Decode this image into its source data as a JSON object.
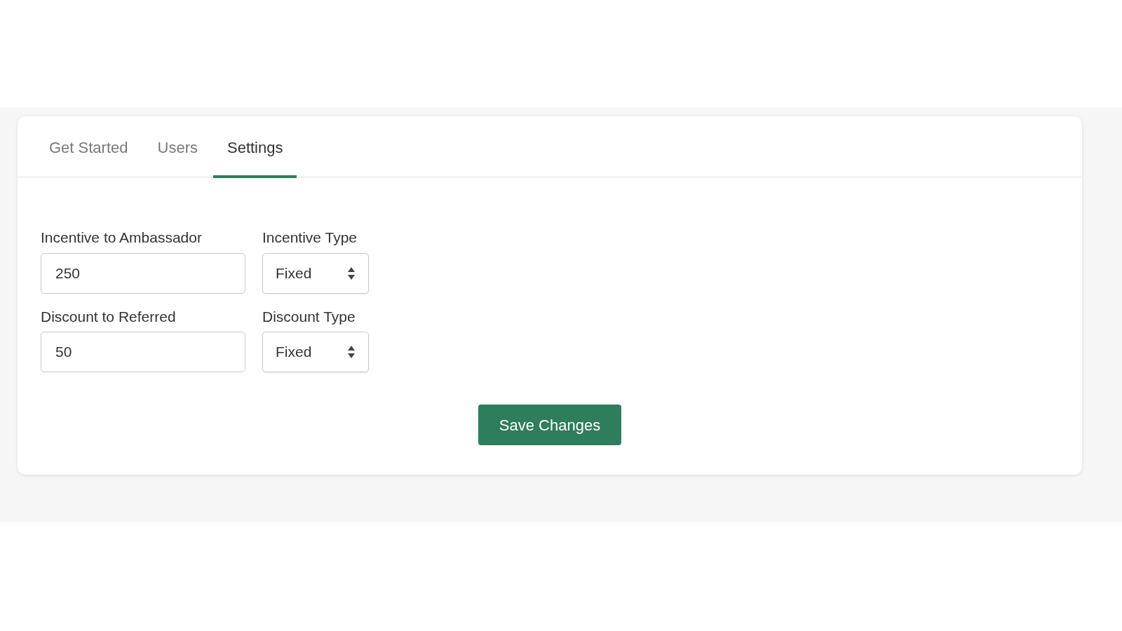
{
  "tabs": [
    {
      "label": "Get Started",
      "selected": false
    },
    {
      "label": "Users",
      "selected": false
    },
    {
      "label": "Settings",
      "selected": true
    }
  ],
  "fields": [
    {
      "label": "Incentive to Ambassador",
      "value": "250",
      "type_label": "Incentive Type",
      "type_value": "Fixed"
    },
    {
      "label": "Discount to Referred",
      "value": "50",
      "type_label": "Discount Type",
      "type_value": "Fixed"
    }
  ],
  "save_button": "Save Changes"
}
